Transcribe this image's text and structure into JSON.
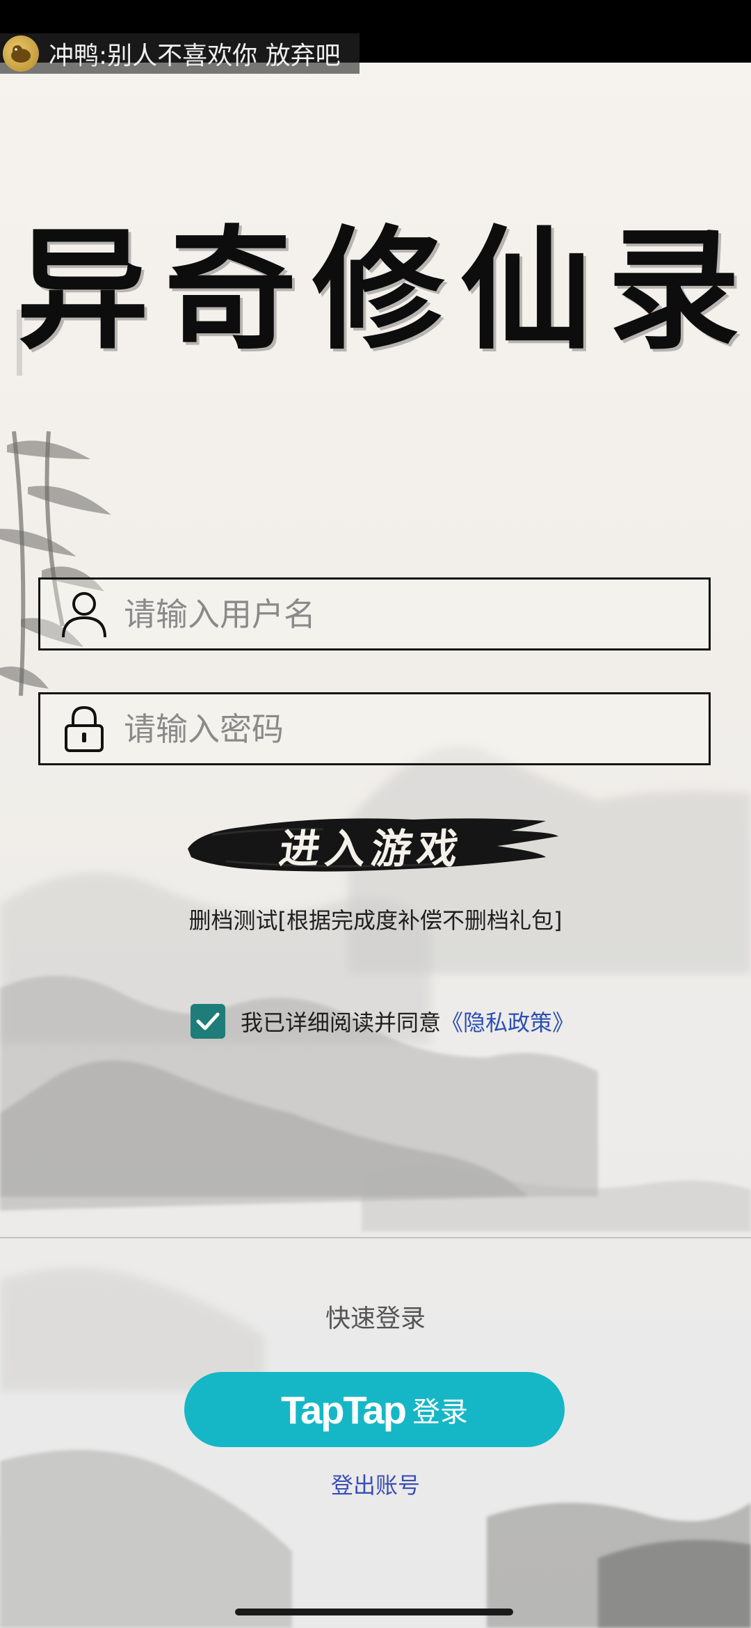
{
  "notification": {
    "text": "冲鸭:别人不喜欢你 放弃吧"
  },
  "title": {
    "chars": [
      "异",
      "奇",
      "修",
      "仙",
      "录"
    ]
  },
  "login": {
    "username_placeholder": "请输入用户名",
    "password_placeholder": "请输入密码",
    "enter_button": "进入游戏",
    "notice": "删档测试[根据完成度补偿不删档礼包]",
    "agreement_text": "我已详细阅读并同意",
    "privacy_link": "《隐私政策》",
    "agreement_checked": true
  },
  "quick_login": {
    "heading": "快速登录",
    "taptap_brand": "TapTap",
    "taptap_label": "登录",
    "logout": "登出账号"
  },
  "colors": {
    "accent_teal": "#15b7c6",
    "checkbox": "#1e7d78",
    "link": "#2b4fb5"
  }
}
